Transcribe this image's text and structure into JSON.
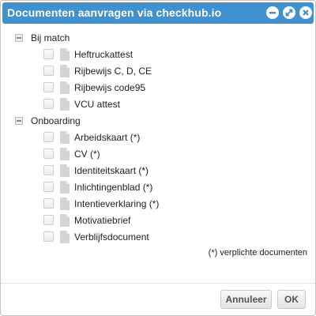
{
  "dialog": {
    "title": "Documenten aanvragen via checkhub.io"
  },
  "groups": [
    {
      "label": "Bij match",
      "items": [
        {
          "label": "Heftruckattest",
          "checked": false,
          "icon": "document-icon"
        },
        {
          "label": "Rijbewijs C, D, CE",
          "checked": false,
          "icon": "document-icon"
        },
        {
          "label": "Rijbewijs code95",
          "checked": false,
          "icon": "document-icon"
        },
        {
          "label": "VCU attest",
          "checked": false,
          "icon": "document-icon"
        }
      ]
    },
    {
      "label": "Onboarding",
      "items": [
        {
          "label": "Arbeidskaart (*)",
          "checked": false,
          "icon": "document-icon"
        },
        {
          "label": "CV (*)",
          "checked": false,
          "icon": "document-icon"
        },
        {
          "label": "Identiteitskaart (*)",
          "checked": false,
          "icon": "document-icon"
        },
        {
          "label": "Inlichtingenblad (*)",
          "checked": false,
          "icon": "document-icon"
        },
        {
          "label": "Intentieverklaring (*)",
          "checked": false,
          "icon": "document-icon"
        },
        {
          "label": "Motivatiebrief",
          "checked": false,
          "icon": "document-icon"
        },
        {
          "label": "Verblijfsdocument",
          "checked": false,
          "icon": "document-icon"
        }
      ]
    }
  ],
  "footnote": "(*) verplichte documenten",
  "buttons": {
    "cancel": "Annuleer",
    "ok": "OK"
  },
  "colors": {
    "titlebar": "#3f92cf",
    "title_text": "#ffffff",
    "icon_gray": "#d4d4d4"
  }
}
